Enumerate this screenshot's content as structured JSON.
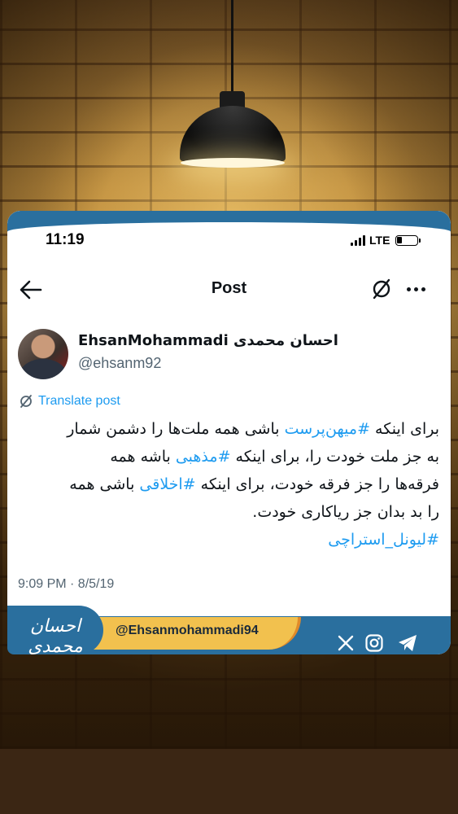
{
  "status_bar": {
    "time": "11:19",
    "network": "LTE"
  },
  "header": {
    "title": "Post"
  },
  "author": {
    "display_name": "EhsanMohammadi احسان محمدی",
    "handle": "@ehsanm92"
  },
  "translate_label": "Translate post",
  "tweet": {
    "lines": [
      [
        {
          "text": "برای اینکه ",
          "tag": false
        },
        {
          "text": "#میهن‌پرست",
          "tag": true
        },
        {
          "text": " باشی همه ملت‌ها را دشمن شمار",
          "tag": false
        }
      ],
      [
        {
          "text": "به جز ملت خودت را، برای اینکه ",
          "tag": false
        },
        {
          "text": "#مذهبی",
          "tag": true
        },
        {
          "text": " باشه همه",
          "tag": false
        }
      ],
      [
        {
          "text": "فرقه‌ها را جز فرقه خودت، برای اینکه ",
          "tag": false
        },
        {
          "text": "#اخلاقی",
          "tag": true
        },
        {
          "text": " باشی همه",
          "tag": false
        }
      ],
      [
        {
          "text": "را بد بدان جز ریاکاری خودت.",
          "tag": false
        }
      ],
      [
        {
          "text": "#لیونل_استراچی",
          "tag": true
        }
      ]
    ]
  },
  "timestamp": "9:09 PM · 8/5/19",
  "branding": {
    "handle": "@Ehsanmohammadi94",
    "logo_text": "احسان محمدی",
    "socials": [
      "x-icon",
      "instagram-icon",
      "telegram-icon"
    ]
  },
  "colors": {
    "accent": "#1d9bf0",
    "brand_blue": "#2a6f9e",
    "brand_yellow": "#f2c14e"
  }
}
